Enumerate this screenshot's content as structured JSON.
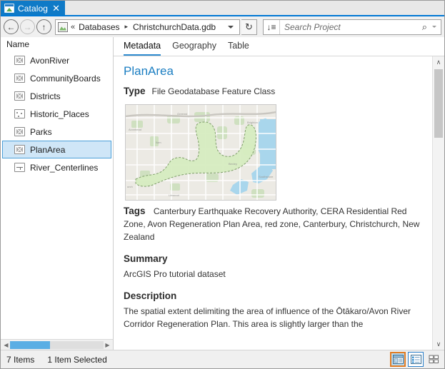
{
  "window": {
    "tab": {
      "label": "Catalog",
      "icon": "catalog-icon",
      "close": "✕"
    }
  },
  "toolbar": {
    "back": "←",
    "forward": "→",
    "up": "↑",
    "collapse": "«",
    "breadcrumbs": [
      "Databases",
      "ChristchurchData.gdb"
    ],
    "separator": "▸",
    "refresh": "↻",
    "sort": "↓≡",
    "search": {
      "value": "",
      "placeholder": "Search Project",
      "icon": "⌕"
    }
  },
  "tree": {
    "column_header": "Name",
    "items": [
      {
        "label": "AvonRiver",
        "icon": "polygon-feature-class-icon",
        "type": "polygon",
        "selected": false
      },
      {
        "label": "CommunityBoards",
        "icon": "polygon-feature-class-icon",
        "type": "polygon",
        "selected": false
      },
      {
        "label": "Districts",
        "icon": "polygon-feature-class-icon",
        "type": "polygon",
        "selected": false
      },
      {
        "label": "Historic_Places",
        "icon": "point-feature-class-icon",
        "type": "point",
        "selected": false
      },
      {
        "label": "Parks",
        "icon": "polygon-feature-class-icon",
        "type": "polygon",
        "selected": false
      },
      {
        "label": "PlanArea",
        "icon": "polygon-feature-class-icon",
        "type": "polygon",
        "selected": true
      },
      {
        "label": "River_Centerlines",
        "icon": "line-feature-class-icon",
        "type": "line",
        "selected": false
      }
    ]
  },
  "view_tabs": [
    {
      "label": "Metadata",
      "active": true
    },
    {
      "label": "Geography",
      "active": false
    },
    {
      "label": "Table",
      "active": false
    }
  ],
  "metadata": {
    "title": "PlanArea",
    "type_label": "Type",
    "type_value": "File Geodatabase Feature Class",
    "thumbnail_alt": "map-thumbnail-christchurch-plan-area",
    "tags_label": "Tags",
    "tags_value": "Canterbury Earthquake Recovery Authority, CERA Residential Red Zone, Avon Regeneration Plan Area, red zone, Canterbury, Christchurch, New Zealand",
    "summary_label": "Summary",
    "summary_value": "ArcGIS Pro tutorial dataset",
    "description_label": "Description",
    "description_value": "The spatial extent delimiting the area of influence of the Ōtākaro/Avon River Corridor Regeneration Plan. This area is slightly larger than the"
  },
  "status": {
    "item_count": "7 Items",
    "selection": "1 Item Selected",
    "view_modes": [
      {
        "name": "details-view",
        "state": "selected"
      },
      {
        "name": "list-view",
        "state": "hover"
      },
      {
        "name": "thumbnail-view",
        "state": "normal"
      }
    ]
  },
  "scroll": {
    "up": "∧",
    "down": "∨",
    "left": "◀",
    "right": "▶"
  },
  "colors": {
    "accent": "#0f7ac7",
    "tab_underline": "#2e8bd0",
    "title": "#1b7ec2",
    "selection_fill": "#cfe6f7",
    "selection_border": "#4a9fd8",
    "hscroll_thumb": "#5aaee4",
    "viewmode_selected_border": "#e07b22"
  }
}
